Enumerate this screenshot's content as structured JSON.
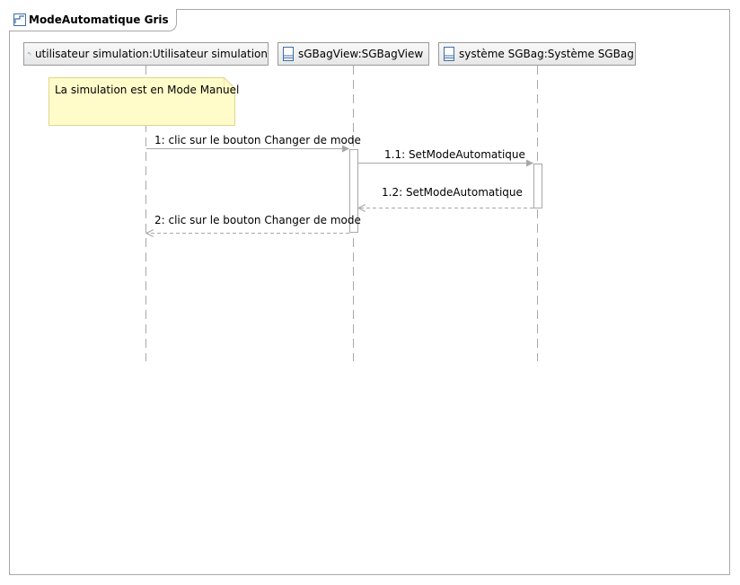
{
  "frame": {
    "title": "ModeAutomatique Gris",
    "icon": "sequence-diagram-icon"
  },
  "lifelines": [
    {
      "label": "utilisateur simulation:Utilisateur simulation",
      "icon": "actor-icon"
    },
    {
      "label": "sGBagView:SGBagView",
      "icon": "class-icon"
    },
    {
      "label": "système SGBag:Système SGBag",
      "icon": "class-icon"
    }
  ],
  "note": {
    "text": "La simulation est en Mode Manuel"
  },
  "messages": [
    {
      "label": "1: clic sur le bouton Changer de mode",
      "kind": "call"
    },
    {
      "label": "1.1: SetModeAutomatique",
      "kind": "call"
    },
    {
      "label": "1.2: SetModeAutomatique",
      "kind": "return"
    },
    {
      "label": "2: clic sur le bouton Changer de mode",
      "kind": "return"
    }
  ],
  "colors": {
    "line": "#a8a8a8",
    "note_fill": "#fffcc9",
    "note_border": "#e1d58a"
  }
}
